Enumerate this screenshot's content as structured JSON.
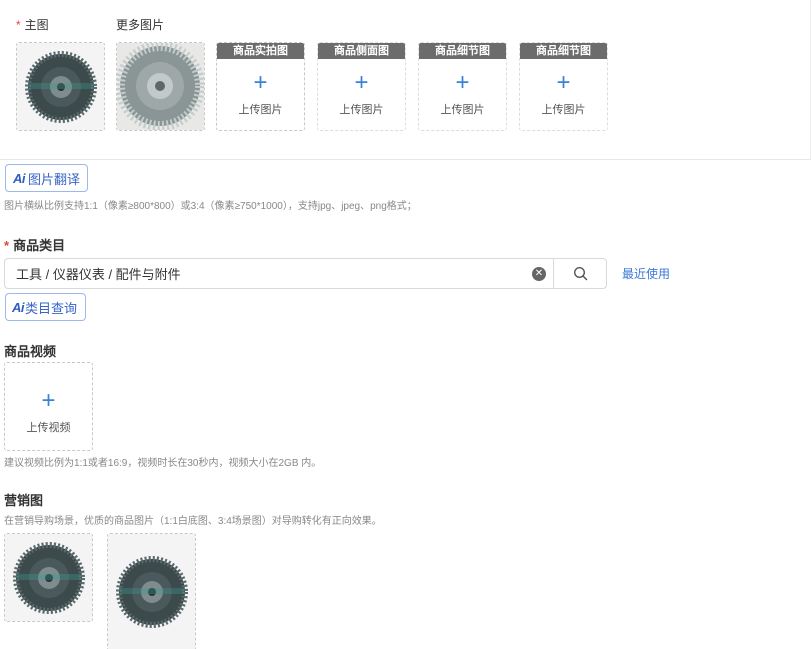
{
  "main_images": {
    "main_label": "主图",
    "main_required": "*",
    "more_label": "更多图片",
    "slots": [
      {
        "tag": "商品实拍图",
        "upload": "上传图片"
      },
      {
        "tag": "商品侧面图",
        "upload": "上传图片"
      },
      {
        "tag": "商品细节图",
        "upload": "上传图片"
      },
      {
        "tag": "商品细节图",
        "upload": "上传图片"
      }
    ]
  },
  "ai_translate": {
    "logo": "Ai",
    "label": "图片翻译"
  },
  "image_hint": "图片横纵比例支持1:1（像素≥800*800）或3:4（像素≥750*1000），支持jpg、jpeg、png格式；",
  "category": {
    "required": "*",
    "title": "商品类目",
    "value": "工具 / 仪器仪表 / 配件与附件",
    "recent": "最近使用",
    "ai_logo": "Ai",
    "ai_label": "类目查询"
  },
  "video": {
    "title": "商品视频",
    "upload": "上传视频",
    "hint": "建议视频比例为1:1或者16:9，视频时长在30秒内，视频大小在2GB 内。"
  },
  "marketing": {
    "title": "营销图",
    "hint": "在营销导购场景，优质的商品图片（1:1白底图、3:4场景图）对导购转化有正向效果。"
  },
  "colors": {
    "accent": "#3a82d8",
    "required": "#e5453a",
    "tag_bg": "#6c6c6c",
    "ai_border": "#9db8ea"
  },
  "icons": [
    "plus-icon",
    "clear-icon",
    "search-icon",
    "ai-logo-icon"
  ]
}
